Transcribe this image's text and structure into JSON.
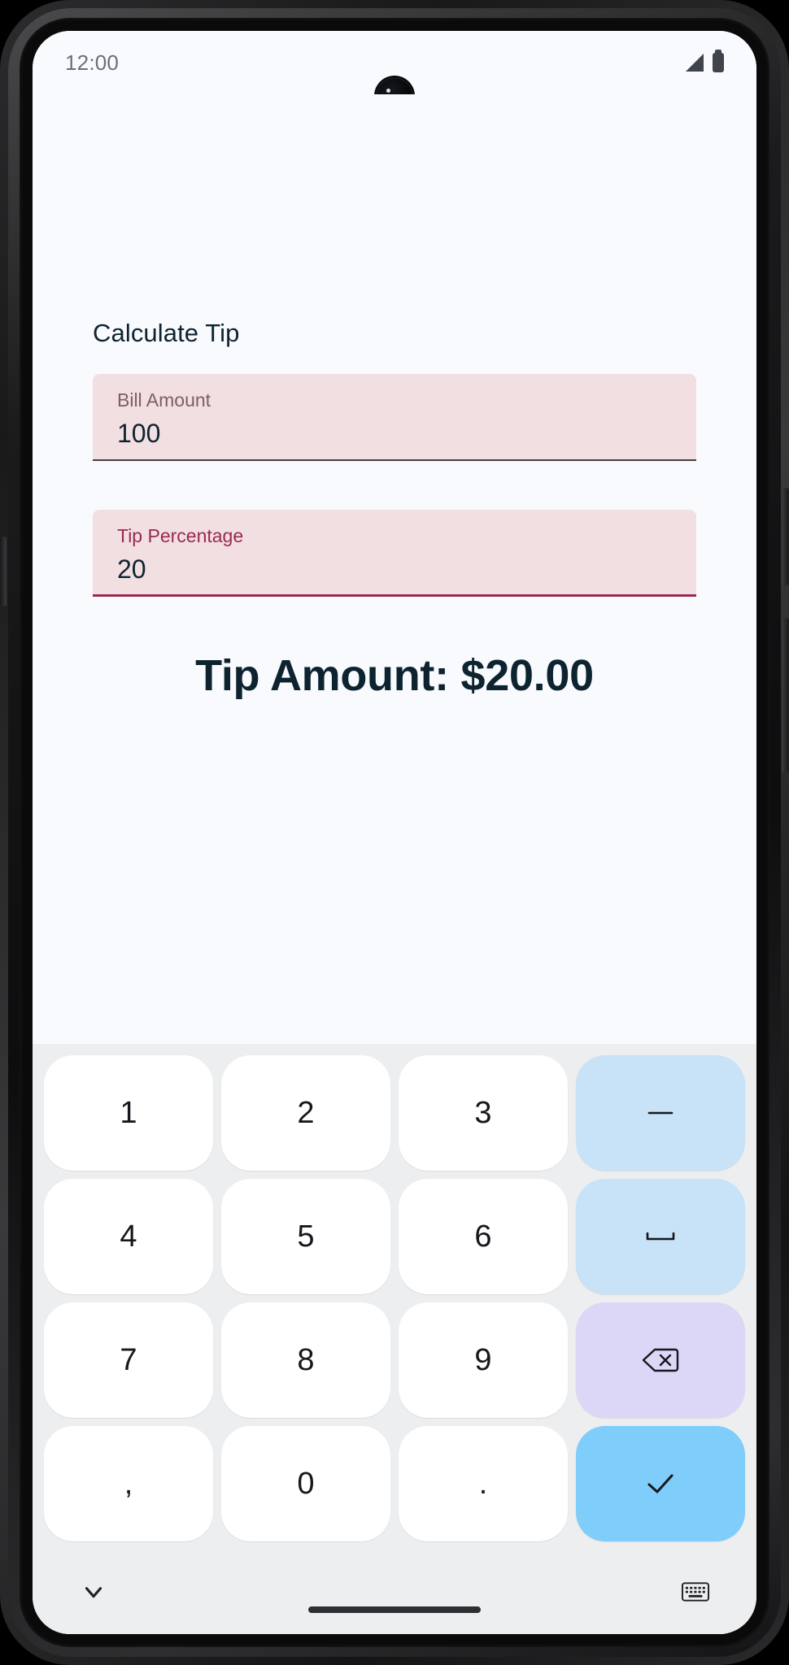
{
  "device": {
    "status_bar": {
      "time": "12:00",
      "signal_icon": "signal-triangle-icon",
      "battery_icon": "battery-full-icon",
      "camera_icon": "front-camera-punch-hole"
    },
    "navigation": {
      "home_indicator": "home-indicator"
    }
  },
  "app": {
    "title": "Calculate Tip",
    "fields": [
      {
        "name": "bill-amount",
        "label": "Bill Amount",
        "value": "100",
        "placeholder": "Bill Amount",
        "focused": false
      },
      {
        "name": "tip-percentage",
        "label": "Tip Percentage",
        "value": "20",
        "placeholder": "Tip Percentage",
        "focused": true
      }
    ],
    "result": "Tip Amount: $20.00"
  },
  "keyboard": {
    "type": "numeric",
    "rows": [
      [
        {
          "label": "1",
          "name": "key-1",
          "style": "plain",
          "icon": ""
        },
        {
          "label": "2",
          "name": "key-2",
          "style": "plain",
          "icon": ""
        },
        {
          "label": "3",
          "name": "key-3",
          "style": "plain",
          "icon": ""
        },
        {
          "label": "–",
          "name": "key-minus",
          "style": "accent-blue",
          "icon": "minus-icon"
        }
      ],
      [
        {
          "label": "4",
          "name": "key-4",
          "style": "plain",
          "icon": ""
        },
        {
          "label": "5",
          "name": "key-5",
          "style": "plain",
          "icon": ""
        },
        {
          "label": "6",
          "name": "key-6",
          "style": "plain",
          "icon": ""
        },
        {
          "label": "",
          "name": "key-space",
          "style": "accent-blue",
          "icon": "space-icon"
        }
      ],
      [
        {
          "label": "7",
          "name": "key-7",
          "style": "plain",
          "icon": ""
        },
        {
          "label": "8",
          "name": "key-8",
          "style": "plain",
          "icon": ""
        },
        {
          "label": "9",
          "name": "key-9",
          "style": "plain",
          "icon": ""
        },
        {
          "label": "",
          "name": "key-backspace",
          "style": "accent-purple",
          "icon": "backspace-icon"
        }
      ],
      [
        {
          "label": ",",
          "name": "key-comma",
          "style": "plain",
          "icon": ""
        },
        {
          "label": "0",
          "name": "key-0",
          "style": "plain",
          "icon": ""
        },
        {
          "label": ".",
          "name": "key-period",
          "style": "plain",
          "icon": ""
        },
        {
          "label": "",
          "name": "key-enter",
          "style": "accent-enter",
          "icon": "checkmark-icon"
        }
      ]
    ],
    "bottom_bar": {
      "dismiss_icon": "chevron-down-icon",
      "switch_keyboard_icon": "keyboard-icon"
    }
  },
  "colors": {
    "screen_bg": "#f9fafd",
    "field_bg": "#f2dfe2",
    "field_focused_accent": "#9a2a52",
    "field_unfocused_accent": "#4c3b3f",
    "text_primary": "#0d2430",
    "keyboard_bg": "#eceef0",
    "key_bg": "#ffffff",
    "key_accent_blue": "#c8e2f7",
    "key_accent_purple": "#dcd6f7",
    "key_accent_enter": "#7fcdfa"
  }
}
